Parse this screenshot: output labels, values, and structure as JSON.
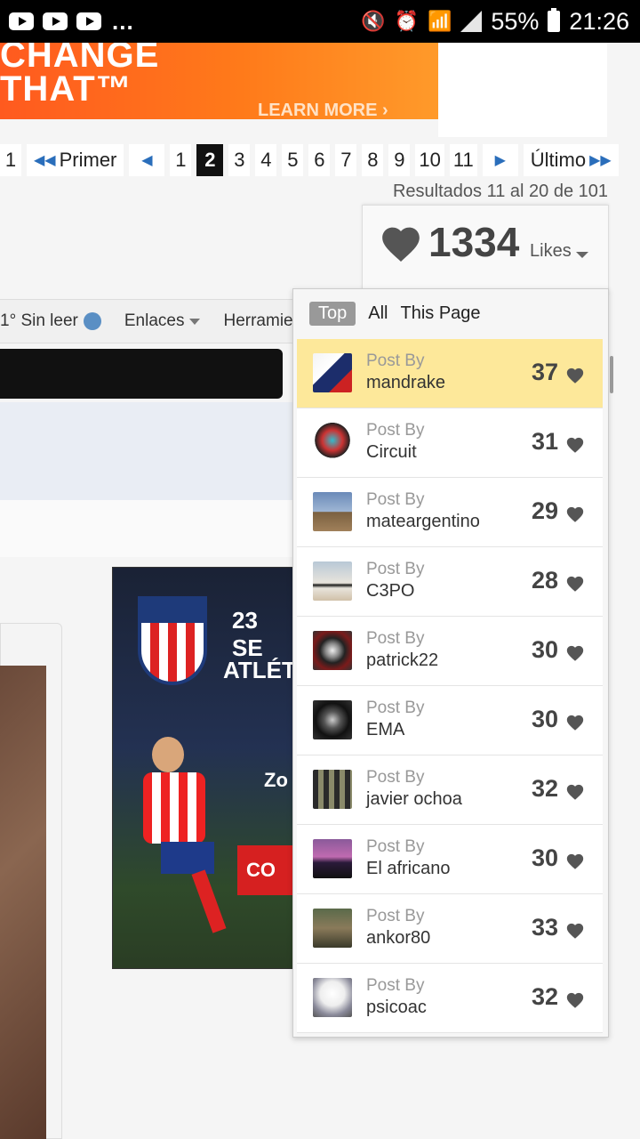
{
  "status_bar": {
    "dots": "...",
    "battery": "55%",
    "time": "21:26"
  },
  "top_ad": {
    "line1": "CHANGE",
    "line2": "THAT™",
    "cta": "LEARN MORE ›"
  },
  "pagination": {
    "first_partial": "1",
    "first_label": "Primer",
    "pages": [
      "1",
      "2",
      "3",
      "4",
      "5",
      "6",
      "7",
      "8",
      "9",
      "10",
      "11"
    ],
    "current_page": "2",
    "last_label": "Último",
    "results": "Resultados 11 al 20 de 101"
  },
  "nav": {
    "unread": "1° Sin leer",
    "links": "Enlaces",
    "tools": "Herramie"
  },
  "atletico_ad": {
    "date": "23 SE",
    "club": "ATLÉT",
    "partial": "Zo",
    "button": "CO"
  },
  "likes": {
    "total": "1334",
    "label": "Likes",
    "tabs": [
      "Top",
      "All",
      "This Page"
    ],
    "active_tab": "Top",
    "post_by": "Post By",
    "entries": [
      {
        "user": "mandrake",
        "count": "37",
        "highlight": true
      },
      {
        "user": "Circuit",
        "count": "31"
      },
      {
        "user": "mateargentino",
        "count": "29"
      },
      {
        "user": "C3PO",
        "count": "28"
      },
      {
        "user": "patrick22",
        "count": "30"
      },
      {
        "user": "EMA",
        "count": "30"
      },
      {
        "user": "javier ochoa",
        "count": "32"
      },
      {
        "user": "El africano",
        "count": "30"
      },
      {
        "user": "ankor80",
        "count": "33"
      },
      {
        "user": "psicoac",
        "count": "32"
      }
    ]
  },
  "colors": {
    "ad_orange": "#ff6a1e",
    "highlight": "#fde89a",
    "page_current": "#111111",
    "arrow_blue": "#2a6ebb"
  }
}
